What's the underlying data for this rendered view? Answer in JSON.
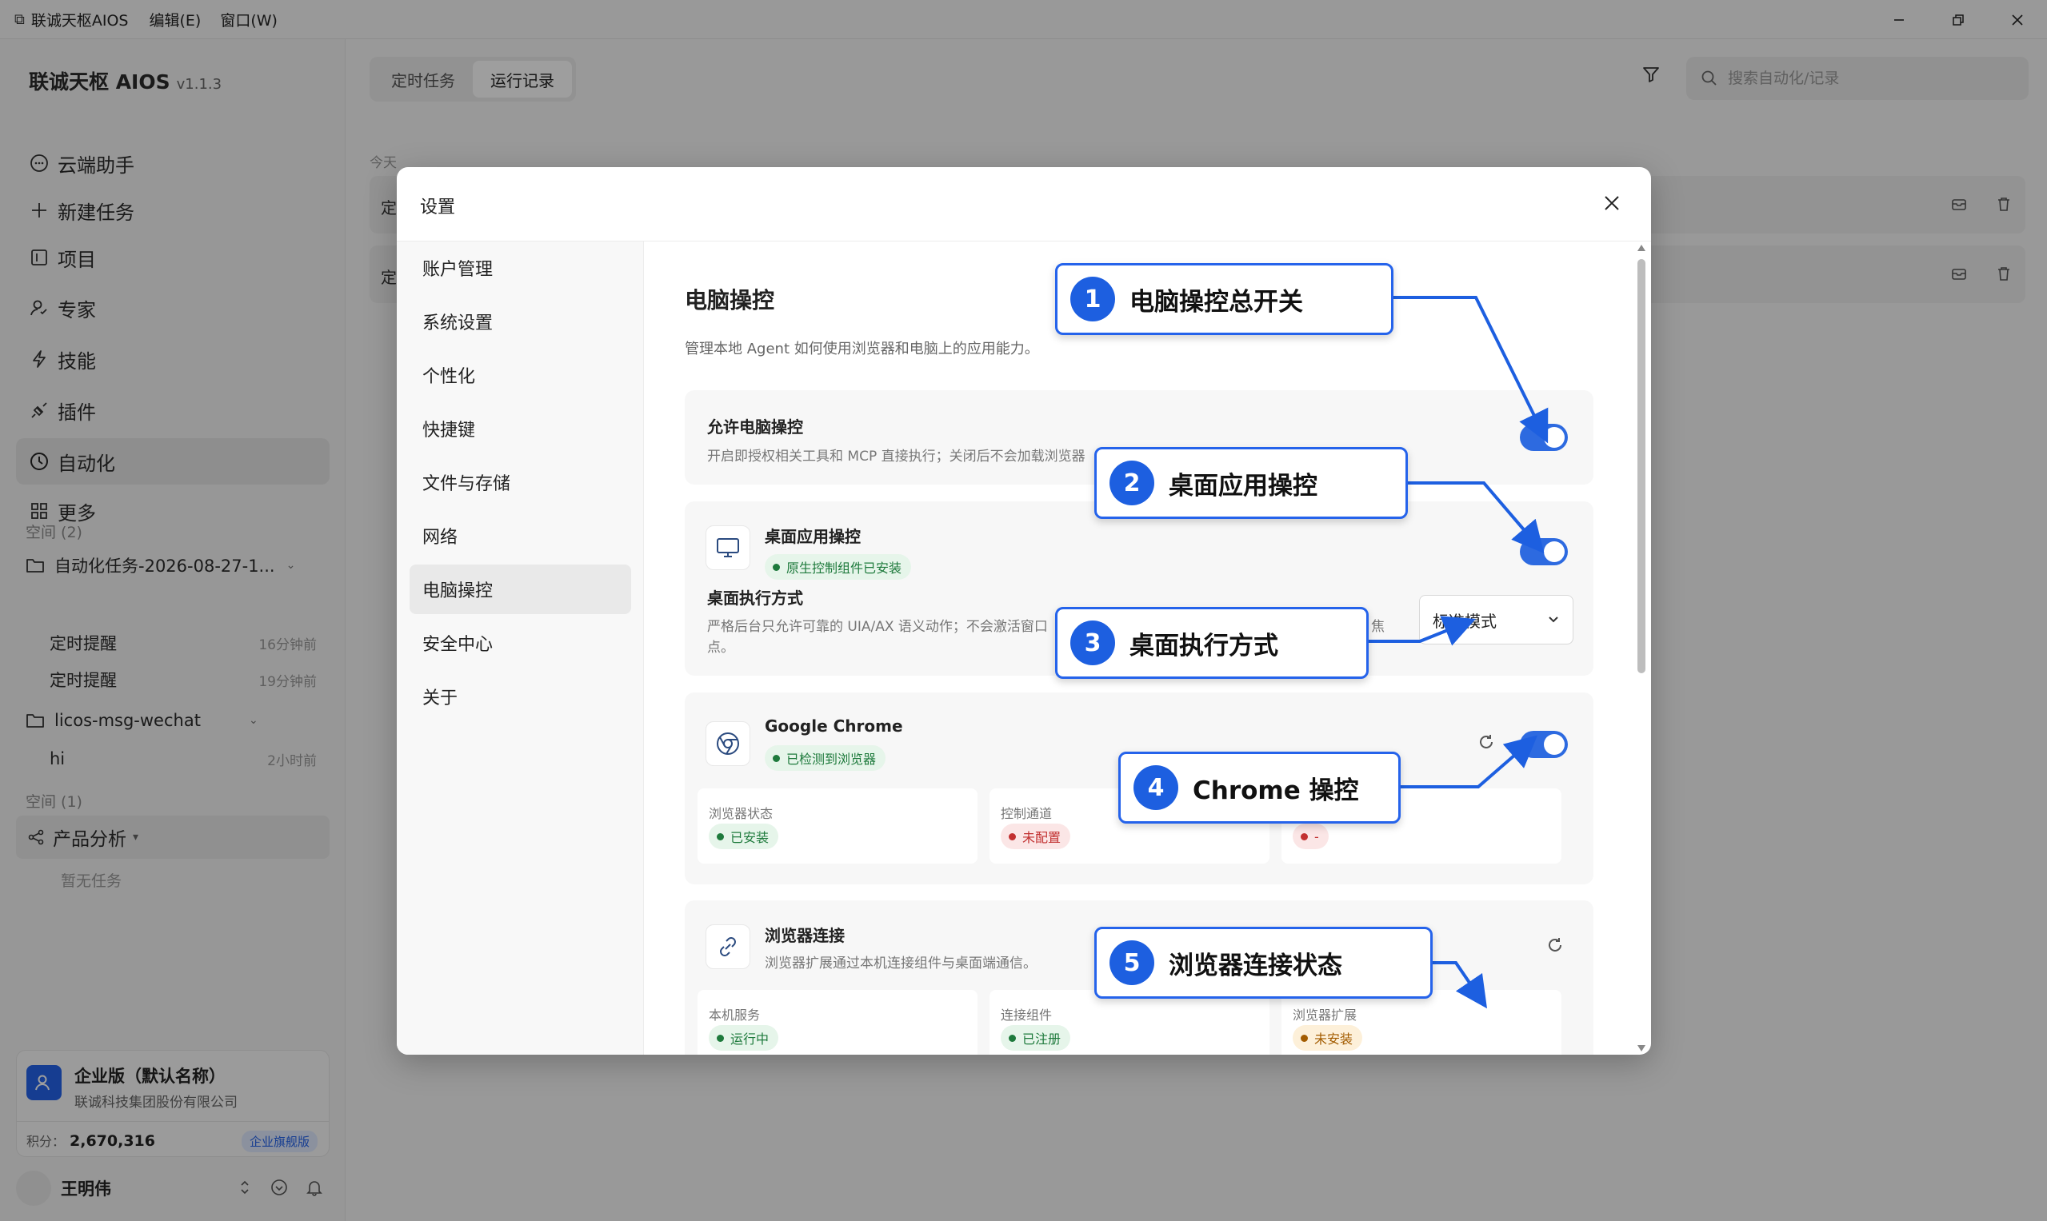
{
  "titlebar": {
    "app_title": "联诚天枢AIOS",
    "menus": [
      "编辑(E)",
      "窗口(W)"
    ]
  },
  "sidebar": {
    "brand": "联诚天枢 AIOS",
    "version": "v1.1.3",
    "nav": [
      {
        "label": "云端助手",
        "icon": "chat-bubble-icon"
      },
      {
        "label": "新建任务",
        "icon": "plus-icon"
      },
      {
        "label": "项目",
        "icon": "project-icon"
      },
      {
        "label": "专家",
        "icon": "expert-icon"
      },
      {
        "label": "技能",
        "icon": "lightning-icon"
      },
      {
        "label": "插件",
        "icon": "plugin-icon"
      },
      {
        "label": "自动化",
        "icon": "clock-icon",
        "active": true
      },
      {
        "label": "更多",
        "icon": "grid-icon"
      }
    ],
    "space1_label": "空间 (2)",
    "folder1": {
      "name": "自动化任务-2026-08-27-1...",
      "items": [
        {
          "name": "定时提醒",
          "time": "16分钟前"
        },
        {
          "name": "定时提醒",
          "time": "19分钟前"
        }
      ]
    },
    "folder2": {
      "name": "licos-msg-wechat",
      "items": [
        {
          "name": "hi",
          "time": "2小时前"
        }
      ]
    },
    "space2_label": "空间 (1)",
    "group": {
      "name": "产品分析",
      "empty": "暂无任务"
    },
    "enterprise": {
      "name": "企业版（默认名称）",
      "company": "联诚科技集团股份有限公司",
      "points_label": "积分：",
      "points": "2,670,316",
      "badge": "企业旗舰版"
    },
    "user": {
      "name": "王明伟"
    }
  },
  "main": {
    "tabs": [
      "定时任务",
      "运行记录"
    ],
    "active_tab": 1,
    "search_placeholder": "搜索自动化/记录",
    "day_label": "今天",
    "records": [
      "定",
      "定"
    ]
  },
  "dialog": {
    "title": "设置",
    "nav": [
      "账户管理",
      "系统设置",
      "个性化",
      "快捷键",
      "文件与存储",
      "网络",
      "电脑操控",
      "安全中心",
      "关于"
    ],
    "active_nav": 6,
    "page_title": "电脑操控",
    "page_desc": "管理本地 Agent 如何使用浏览器和电脑上的应用能力。",
    "allow": {
      "title": "允许电脑操控",
      "desc": "开启即授权相关工具和 MCP 直接执行；关闭后不会加载浏览器",
      "enabled": true
    },
    "desktop": {
      "title": "桌面应用操控",
      "status": "原生控制组件已安装",
      "enabled": true,
      "mode_title": "桌面执行方式",
      "mode_desc_1": "严格后台只允许可靠的 UIA/AX 语义动作；不会激活窗口",
      "mode_desc_tail": "焦",
      "mode_desc_2": "点。",
      "mode_value": "标准模式"
    },
    "chrome": {
      "title": "Google Chrome",
      "status": "已检测到浏览器",
      "enabled": true,
      "cells": [
        {
          "label": "浏览器状态",
          "value": "已安装",
          "tone": "green"
        },
        {
          "label": "控制通道",
          "value": "未配置",
          "tone": "red"
        },
        {
          "label": "",
          "value": "-",
          "tone": "red"
        }
      ]
    },
    "connection": {
      "title": "浏览器连接",
      "desc": "浏览器扩展通过本机连接组件与桌面端通信。",
      "cells": [
        {
          "label": "本机服务",
          "value": "运行中",
          "tone": "green"
        },
        {
          "label": "连接组件",
          "value": "已注册",
          "tone": "green"
        },
        {
          "label": "浏览器扩展",
          "value": "未安装",
          "tone": "orange"
        }
      ]
    }
  },
  "callouts": [
    {
      "num": "1",
      "text": "电脑操控总开关"
    },
    {
      "num": "2",
      "text": "桌面应用操控"
    },
    {
      "num": "3",
      "text": "桌面执行方式"
    },
    {
      "num": "4",
      "text": "Chrome 操控"
    },
    {
      "num": "5",
      "text": "浏览器连接状态"
    }
  ],
  "colors": {
    "accent": "#2563eb",
    "toggle_on": "#2d6ae0",
    "green": "#1e7a3c",
    "red": "#c23030",
    "orange": "#a35c00"
  }
}
